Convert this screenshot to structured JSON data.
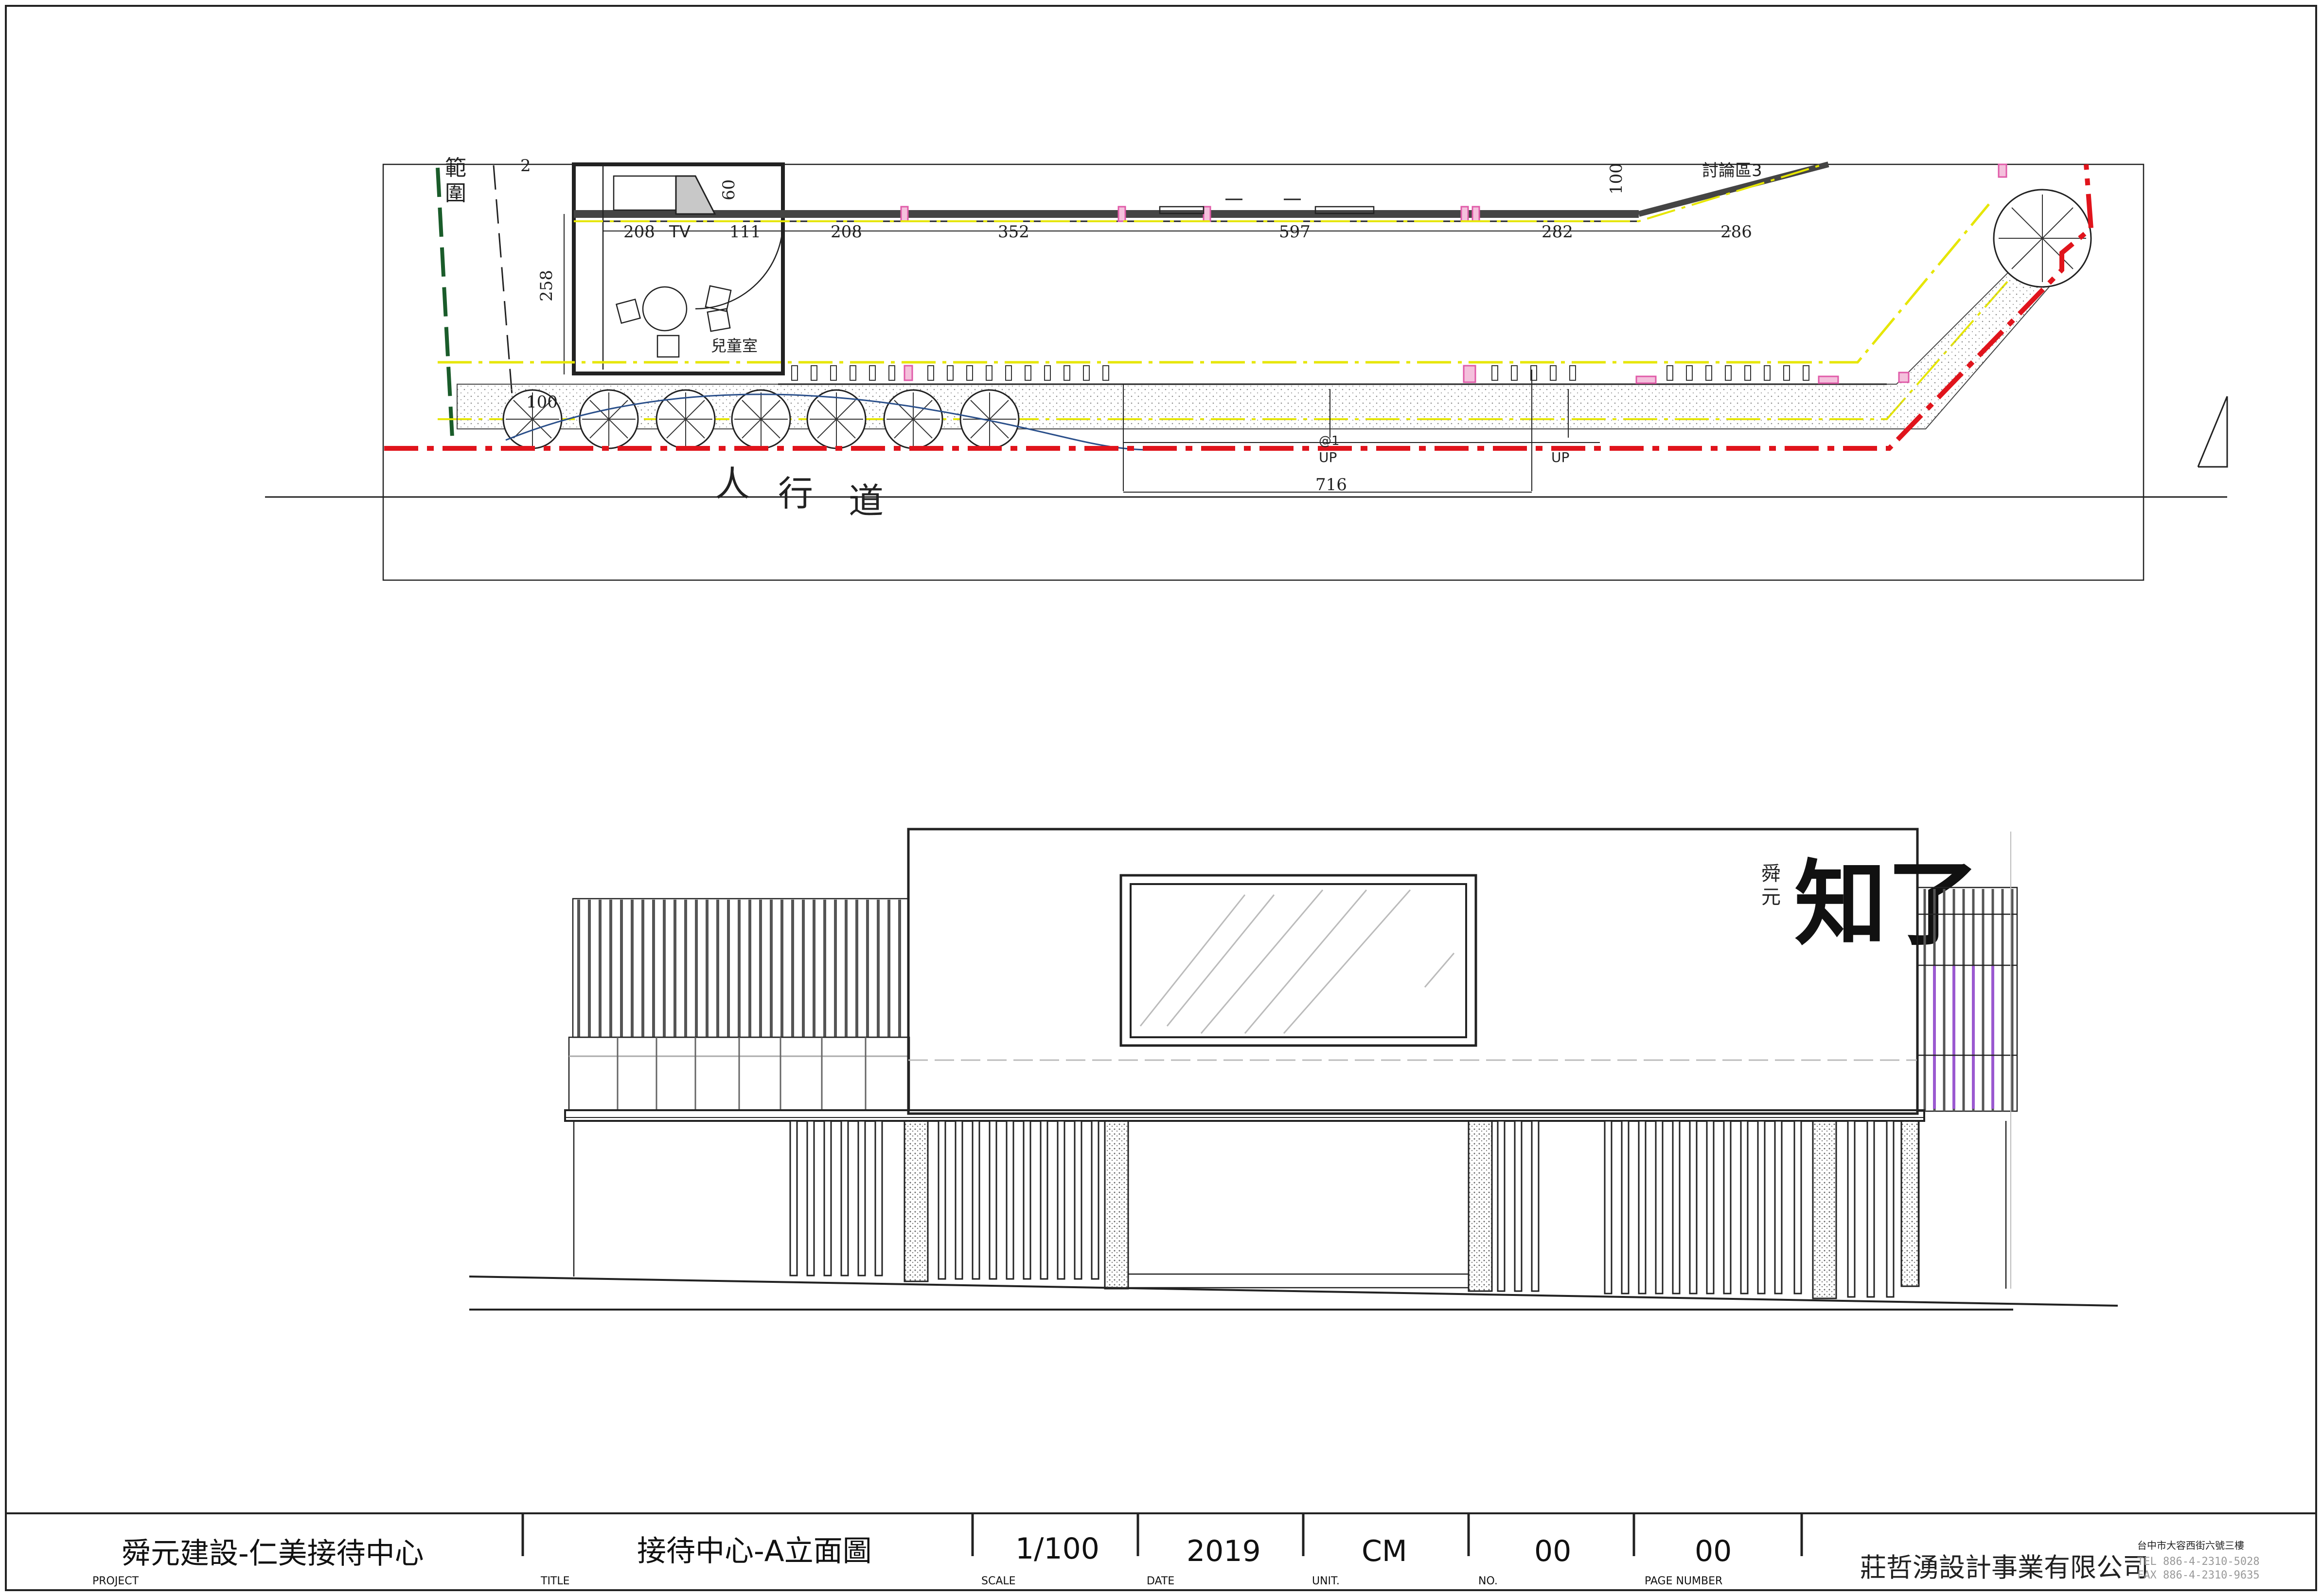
{
  "plan": {
    "dims_top": [
      "208",
      "TV",
      "111",
      "208",
      "352",
      "597",
      "282",
      "286"
    ],
    "dim_60": "60",
    "dim_100_top": "100",
    "dim_258": "258",
    "dim_100_tree": "100",
    "dim_716": "716",
    "dim_2": "2",
    "label_discussion": "討論區3",
    "label_children_room": "兒童室",
    "label_range": [
      "範",
      "圍"
    ],
    "label_at1": "@1",
    "label_up1": "UP",
    "label_up2": "UP",
    "sidewalk": [
      "人",
      "行",
      "道"
    ]
  },
  "elevation": {
    "logo_small": [
      "舜",
      "元"
    ],
    "logo_big": "知了"
  },
  "title_block": {
    "project_value": "舜元建設-仁美接待中心",
    "project_caption": "PROJECT",
    "title_value": "接待中心-A立面圖",
    "title_caption": "TITLE",
    "scale_value": "1/100",
    "scale_caption": "SCALE",
    "date_value": "2019",
    "date_caption": "DATE",
    "unit_value": "CM",
    "unit_caption": "UNIT.",
    "no_value": "00",
    "no_caption": "NO.",
    "page_value": "00",
    "page_caption": "PAGE NUMBER",
    "company": "莊哲湧設計事業有限公司",
    "address": "台中市大容西街六號三樓",
    "tel": "TEL  886-4-2310-5028",
    "fax": "FAX  886-4-2310-9635"
  },
  "colors": {
    "boundary_red": "#e0141c",
    "yellow_line": "#e6e600",
    "green_line": "#1a5c2a",
    "purple": "#9b59d0",
    "pink": "#e05aa8"
  }
}
